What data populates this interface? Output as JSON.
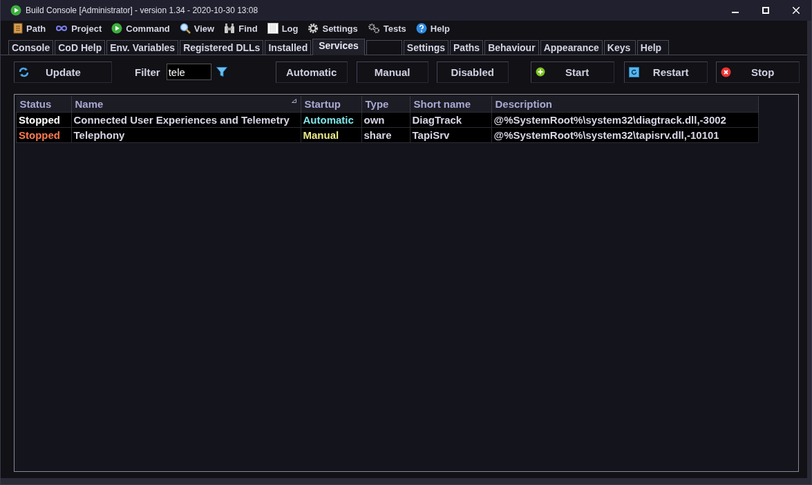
{
  "window": {
    "title": "Build Console [Administrator] - version 1.34 - 2020-10-30 13:08"
  },
  "menu": [
    {
      "label": "Path"
    },
    {
      "label": "Project"
    },
    {
      "label": "Command"
    },
    {
      "label": "View"
    },
    {
      "label": "Find"
    },
    {
      "label": "Log"
    },
    {
      "label": "Settings"
    },
    {
      "label": "Tests"
    },
    {
      "label": "Help"
    }
  ],
  "tabs_left": [
    {
      "label": "Console",
      "selected": false
    },
    {
      "label": "CoD Help",
      "selected": false
    },
    {
      "label": "Env. Variables",
      "selected": false
    },
    {
      "label": "Registered DLLs",
      "selected": false
    },
    {
      "label": "Installed",
      "selected": false
    },
    {
      "label": "Services",
      "selected": true
    }
  ],
  "tabs_right": [
    {
      "label": "Settings",
      "selected": false
    },
    {
      "label": "Paths",
      "selected": false
    },
    {
      "label": "Behaviour",
      "selected": false
    },
    {
      "label": "Appearance",
      "selected": false
    },
    {
      "label": "Keys",
      "selected": false
    },
    {
      "label": "Help",
      "selected": false
    }
  ],
  "toolbar": {
    "update": "Update",
    "filter_label": "Filter",
    "filter_value": "tele",
    "startup_buttons": [
      "Automatic",
      "Manual",
      "Disabled"
    ],
    "action_buttons": [
      "Start",
      "Restart",
      "Stop"
    ]
  },
  "table": {
    "columns": [
      "Status",
      "Name",
      "Startup",
      "Type",
      "Short name",
      "Description"
    ],
    "rows": [
      {
        "status": {
          "text": "Stopped",
          "color": "#ffffff"
        },
        "name": "Connected User Experiences and Telemetry",
        "startup": {
          "text": "Automatic",
          "color": "#7fe3e8"
        },
        "type": "own",
        "short_name": "DiagTrack",
        "description": "@%SystemRoot%\\system32\\diagtrack.dll,-3002"
      },
      {
        "status": {
          "text": "Stopped",
          "color": "#ff7a50"
        },
        "name": "Telephony",
        "startup": {
          "text": "Manual",
          "color": "#ecea8a"
        },
        "type": "share",
        "short_name": "TapiSrv",
        "description": "@%SystemRoot%\\system32\\tapisrv.dll,-10101"
      }
    ]
  }
}
